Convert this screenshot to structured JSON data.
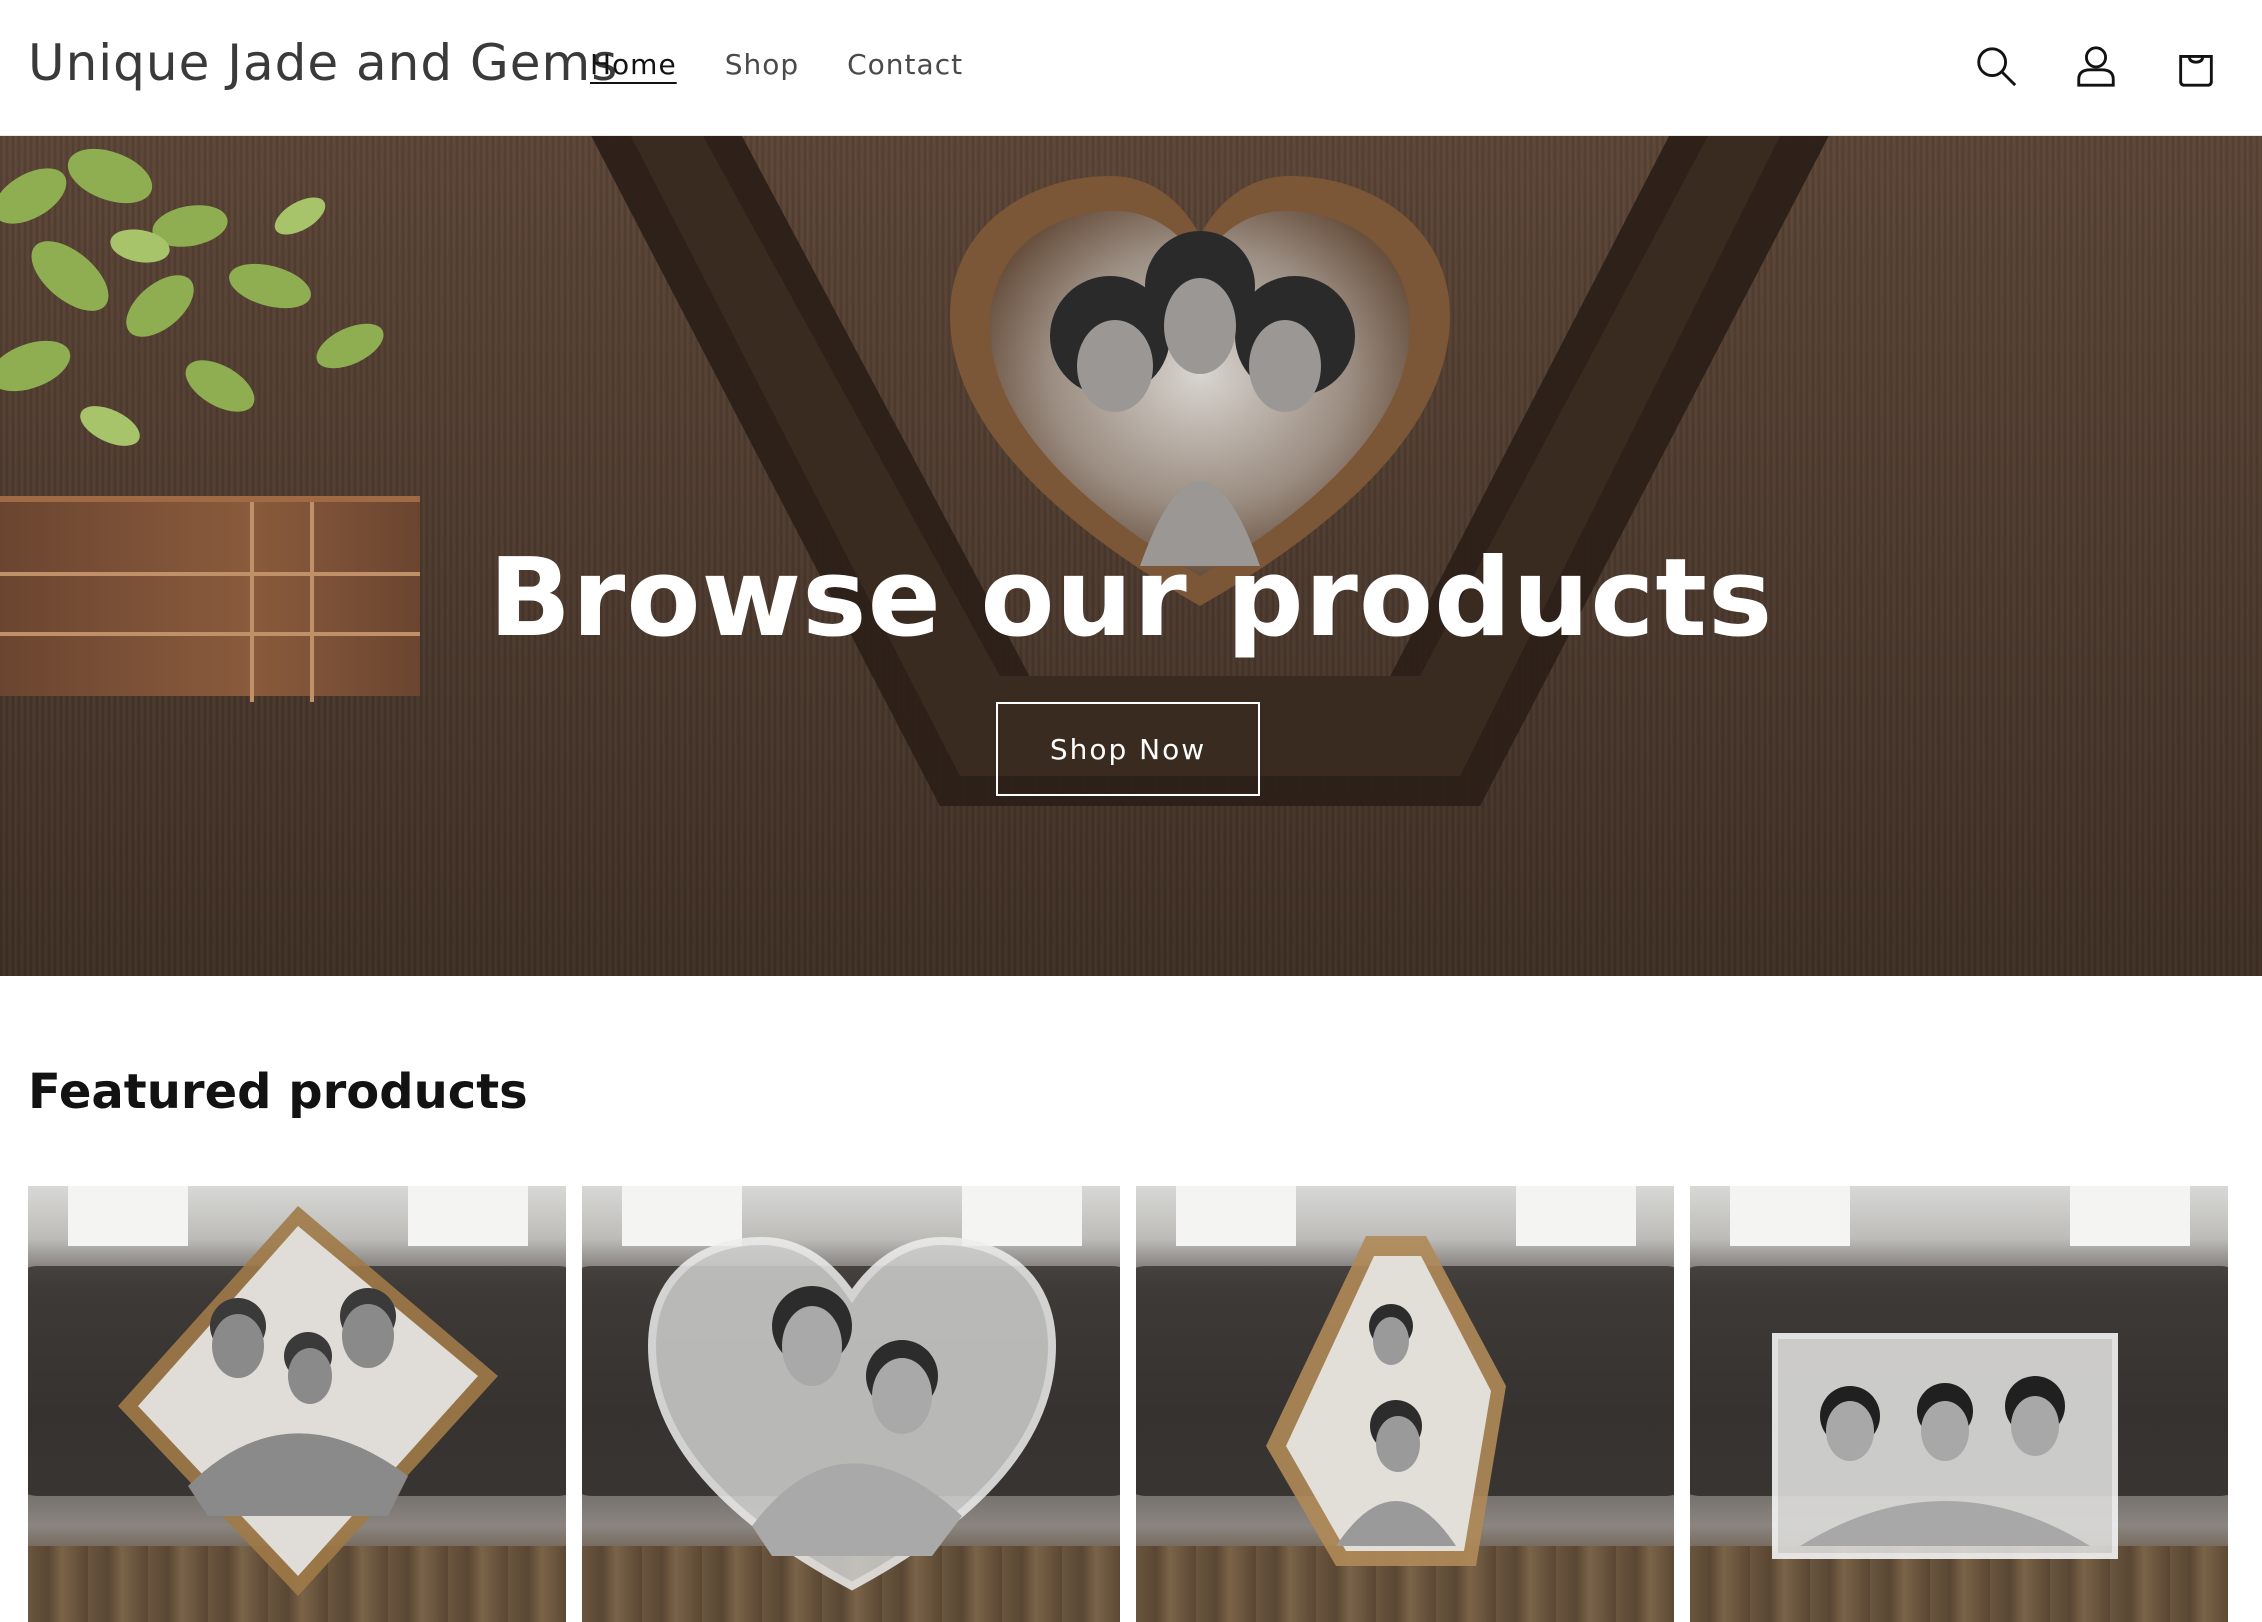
{
  "header": {
    "logo": "Unique Jade and Gems",
    "nav": [
      {
        "label": "Home",
        "active": true
      },
      {
        "label": "Shop",
        "active": false
      },
      {
        "label": "Contact",
        "active": false
      }
    ],
    "icons": [
      "search-icon",
      "account-icon",
      "cart-icon"
    ]
  },
  "hero": {
    "title": "Browse our products",
    "button_label": "Shop Now"
  },
  "featured": {
    "title": "Featured products",
    "products": [
      {
        "image": "diamond-crystal-family-photo"
      },
      {
        "image": "heart-crystal-couple-photo"
      },
      {
        "image": "iceberg-crystal-father-child-photo"
      },
      {
        "image": "rectangle-crystal-family-photo"
      }
    ]
  },
  "colors": {
    "text": "#121212",
    "hero_wood": "#4d3a2e",
    "header_bg": "#ffffff"
  }
}
